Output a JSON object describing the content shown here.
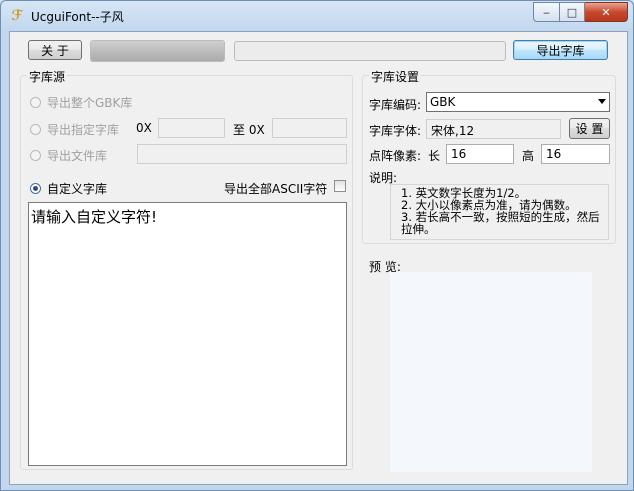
{
  "window": {
    "title": "UcguiFont--子风",
    "controls": {
      "minimize": "‒",
      "maximize": "□",
      "close": "✕"
    }
  },
  "toolbar": {
    "about_label": "关 于",
    "export_label": "导出字库",
    "progress_fraction": 1.0
  },
  "source": {
    "group_label": "字库源",
    "option_gbk": "导出整个GBK库",
    "option_range": "导出指定字库",
    "range_from_prefix": "0X",
    "range_to_label": "至 0X",
    "range_from_value": "",
    "range_to_value": "",
    "option_file": "导出文件库",
    "file_value": "",
    "option_custom": "自定义字库",
    "ascii_label": "导出全部ASCII字符",
    "ascii_checked": false,
    "custom_text": "请输入自定义字符!"
  },
  "settings": {
    "group_label": "字库设置",
    "encoding_label": "字库编码:",
    "encoding_value": "GBK",
    "font_label": "字库字体:",
    "font_value": "宋体,12",
    "set_button": "设 置",
    "pixel_label": "点阵像素:",
    "width_label": "长",
    "width_value": "16",
    "height_label": "高",
    "height_value": "16",
    "notes_label": "说明:",
    "notes": [
      "1. 英文数字长度为1/2。",
      "2. 大小以像素点为准，请为偶数。",
      "3. 若长高不一致，按照短的生成，然后拉伸。"
    ]
  },
  "preview": {
    "label": "预 览:"
  }
}
